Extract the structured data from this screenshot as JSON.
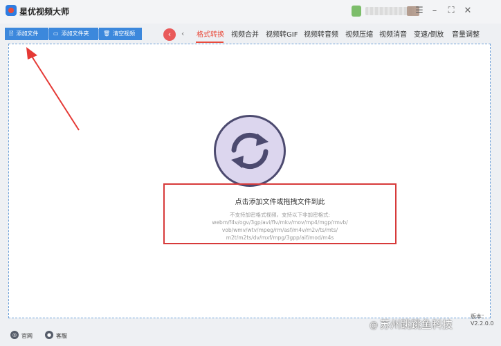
{
  "app": {
    "title": "星优视频大师"
  },
  "toolbar": {
    "add_file": "添加文件",
    "add_folder": "添加文件夹",
    "clear_videos": "清空视频"
  },
  "tabs": [
    {
      "label": "格式转换",
      "active": true
    },
    {
      "label": "视频合并"
    },
    {
      "label": "视频转GIF"
    },
    {
      "label": "视频转音频"
    },
    {
      "label": "视频压缩"
    },
    {
      "label": "视频消音"
    },
    {
      "label": "变速/倒放"
    },
    {
      "label": "音量调整"
    }
  ],
  "drop_area": {
    "prompt": "点击添加文件或拖拽文件到此",
    "format_lines": [
      "不支持加密格式视频，支持以下非加密格式:",
      "webm/f4v/ogv/3gp/avi/flv/mkv/mov/mp4/mgp/rmvb/",
      "vob/wmv/wtv/mpeg/rm/asf/m4v/m2v/ts/mts/",
      "m2t/m2ts/dv/mxf/mpg/3gpp/aif/mod/m4s"
    ]
  },
  "footer": {
    "official_site": "官网",
    "support": "客服",
    "version": "版本：V2.2.0.0"
  },
  "watermark": {
    "at": "@",
    "text": "苏州跳跳鱼科技"
  },
  "colors": {
    "accent_blue": "#3c88dc",
    "active_red": "#e94b3c",
    "highlight_red": "#d73a3a",
    "circle_fill": "#dcd6ee"
  },
  "icons": {
    "file": "file-icon",
    "folder": "folder-icon",
    "trash": "trash-icon",
    "refresh": "refresh-icon",
    "globe": "globe-icon",
    "chat": "chat-icon"
  }
}
